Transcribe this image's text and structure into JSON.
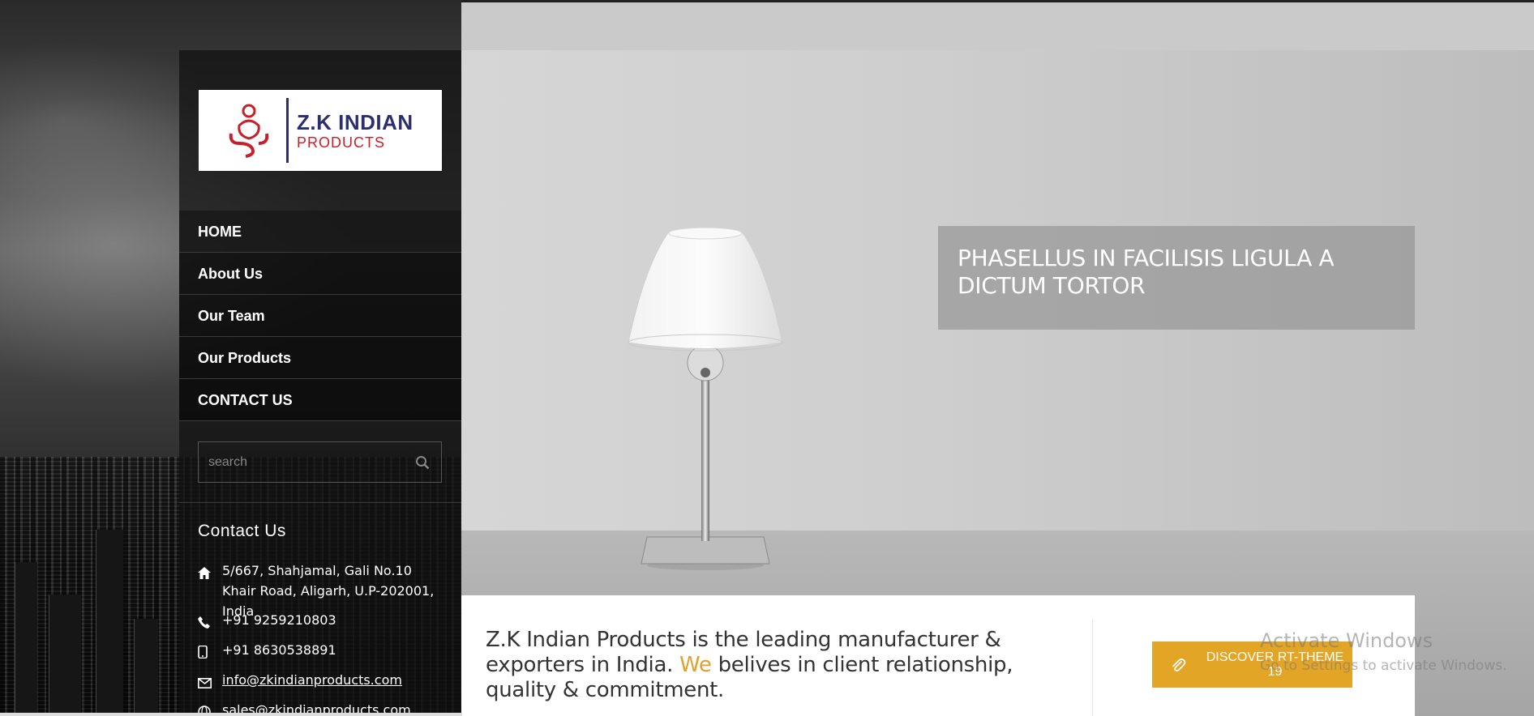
{
  "brand": {
    "logo_title": "Z.K INDIAN",
    "logo_sub": "PRODUCTS",
    "logo_colors": {
      "navy": "#2c2e6e",
      "red": "#c8202a"
    }
  },
  "nav": {
    "items": [
      {
        "label": "HOME"
      },
      {
        "label": "About Us"
      },
      {
        "label": "Our Team"
      },
      {
        "label": "Our Products"
      },
      {
        "label": "CONTACT US"
      }
    ]
  },
  "search": {
    "placeholder": "search",
    "icon": "search-icon"
  },
  "contact": {
    "title": "Contact Us",
    "address": "5/667, Shahjamal, Gali No.10 Khair Road, Aligarh, U.P-202001, India",
    "phone": "+91 9259210803",
    "mobile": "+91 8630538891",
    "email": "info@zkindianproducts.com",
    "email2": "sales@zkindianproducts.com",
    "icons": [
      "home-icon",
      "phone-icon",
      "mobile-icon",
      "mail-icon",
      "globe-icon"
    ]
  },
  "hero": {
    "caption": "PHASELLUS IN FACILISIS LIGULA A DICTUM TORTOR"
  },
  "band": {
    "text_before": "Z.K Indian Products is the leading manufacturer & exporters in India. ",
    "highlight": "We",
    "text_after": " belives in client relationship, quality & commitment.",
    "button_label": "DISCOVER RT-THEME 19",
    "accent": "#e3a526"
  },
  "watermark": {
    "title": "Activate Windows",
    "subtitle": "Go to Settings to activate Windows."
  }
}
